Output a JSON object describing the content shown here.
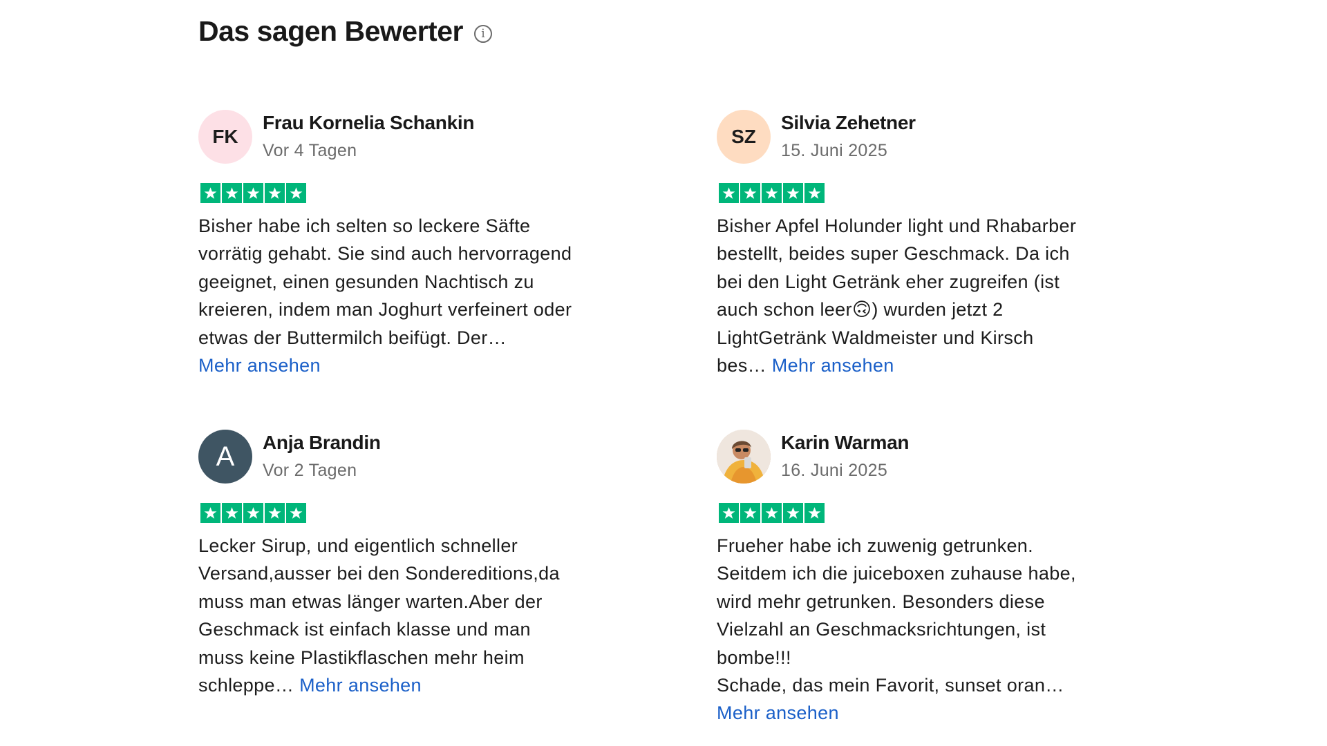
{
  "section": {
    "title": "Das sagen Bewerter",
    "info_icon": "info-icon"
  },
  "colors": {
    "star_green": "#00b67a",
    "link_blue": "#1a5fc8",
    "avatar_pink": "#fde0e6",
    "avatar_peach": "#fedcc1",
    "avatar_slate": "#3f5563"
  },
  "reviews": [
    {
      "initials": "FK",
      "name": "Frau Kornelia Schankin",
      "date": "Vor 4 Tagen",
      "rating": 5,
      "lines": [
        "Bisher habe ich selten so leckere Säfte",
        "vorrätig gehabt. Sie sind auch hervorragend",
        "geeignet, einen gesunden Nachtisch zu",
        "kreieren, indem man Joghurt verfeinert oder",
        "etwas der Buttermilch beifügt. Der…"
      ],
      "tail": "",
      "more_label": "Mehr ansehen"
    },
    {
      "initials": "SZ",
      "name": "Silvia Zehetner",
      "date": "15. Juni 2025",
      "rating": 5,
      "lines": [
        "Bisher Apfel Holunder light und Rhabarber",
        "bestellt, beides super Geschmack. Da ich",
        "bei den Light Getränk eher zugreifen (ist",
        "auch schon leer🙃) wurden jetzt 2",
        "LightGetränk Waldmeister und Kirsch"
      ],
      "tail": "bes… ",
      "more_label": "Mehr ansehen"
    },
    {
      "initials": "A",
      "name": "Anja Brandin",
      "date": "Vor 2 Tagen",
      "rating": 5,
      "lines": [
        "Lecker Sirup, und eigentlich schneller",
        "Versand,ausser bei den Sondereditions,da",
        "muss man etwas länger warten.Aber der",
        "Geschmack ist einfach klasse und man",
        "muss keine Plastikflaschen mehr heim"
      ],
      "tail": "schleppe… ",
      "more_label": "Mehr ansehen"
    },
    {
      "initials": "",
      "name": "Karin Warman",
      "date": "16. Juni 2025",
      "rating": 5,
      "lines": [
        "Frueher habe ich zuwenig getrunken.",
        "Seitdem ich die juiceboxen zuhause habe,",
        "wird mehr getrunken. Besonders diese",
        "Vielzahl an Geschmacksrichtungen, ist",
        "bombe!!!",
        "Schade, das mein Favorit, sunset oran…"
      ],
      "tail": "",
      "more_label": "Mehr ansehen"
    }
  ]
}
